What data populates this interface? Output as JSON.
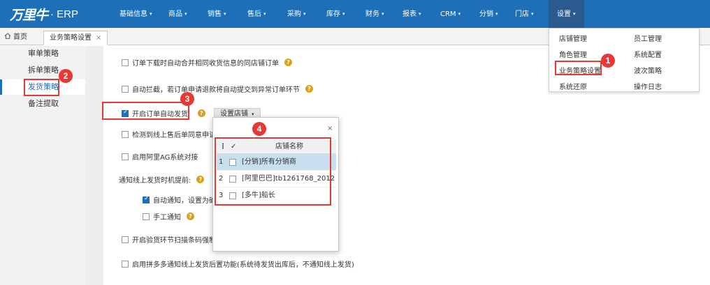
{
  "brand": {
    "mark": "万里牛",
    "product": "· ERP"
  },
  "nav": {
    "items": [
      {
        "label": "基础信息"
      },
      {
        "label": "商品"
      },
      {
        "label": "销售"
      },
      {
        "label": "售后"
      },
      {
        "label": "采购"
      },
      {
        "label": "库存"
      },
      {
        "label": "财务"
      },
      {
        "label": "报表"
      },
      {
        "label": "CRM"
      },
      {
        "label": "分销"
      },
      {
        "label": "门店"
      },
      {
        "label": "设置"
      }
    ],
    "caret": "▾"
  },
  "tabs": {
    "home": "首页",
    "home_icon": "home-icon",
    "active": "业务策略设置",
    "close": "×"
  },
  "sidebar": {
    "items": [
      {
        "label": "审单策略"
      },
      {
        "label": "拆单策略"
      },
      {
        "label": "发货策略"
      },
      {
        "label": "备注提取"
      }
    ]
  },
  "settings_menu": {
    "items": [
      {
        "label": "店铺管理"
      },
      {
        "label": "员工管理"
      },
      {
        "label": "角色管理"
      },
      {
        "label": "系统配置"
      },
      {
        "label": "业务策略设置"
      },
      {
        "label": "波次策略"
      },
      {
        "label": "系统还原"
      },
      {
        "label": "操作日志"
      }
    ]
  },
  "options": {
    "merge_orders": "订单下载时自动合并相同收货信息的同店铺订单",
    "auto_intercept": "自动拦截，若订单申请退款将自动提交到异常订单环节",
    "auto_ship": "开启订单自动发货",
    "set_shop_button": "设置店铺",
    "detect_refund": "检测到线上售后单同意申请后",
    "alibaba_ag": "启用阿里AG系统对接",
    "notify_timing_label": "通知线上发货时机提前:",
    "auto_notify": "自动通知，设置为确",
    "manual_notify": "手工通知",
    "scan_barcode": "开启验货环节扫描条码强制提",
    "pdd_notify": "启用拼多多通知线上发货后置功能(系统待发货出库后，不通知线上发货)",
    "help": "?"
  },
  "shop_modal": {
    "close": "×",
    "col_index": "⋮",
    "col_check": "✓",
    "col_name": "店铺名称",
    "rows": [
      {
        "index": "1",
        "name": "[分销]所有分销商"
      },
      {
        "index": "2",
        "name": "[阿里巴巴]tb1261768_2012"
      },
      {
        "index": "3",
        "name": "[多牛]船长"
      }
    ]
  },
  "annotations": [
    "1",
    "2",
    "3",
    "4"
  ],
  "colors": {
    "nav_bg": "#1d6fb8",
    "nav_active": "#2a5a8e",
    "annotation_red": "#e53935",
    "help_icon": "#d8a21b",
    "row_selected": "#c8dff0"
  }
}
